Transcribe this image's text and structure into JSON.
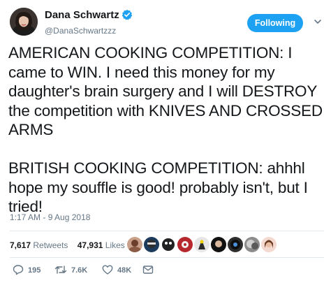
{
  "author": {
    "display_name": "Dana Schwartz",
    "handle": "@DanaSchwartzzz",
    "verified": true
  },
  "follow_button": {
    "label": "Following"
  },
  "tweet": {
    "text": "AMERICAN COOKING COMPETITION: I\ncame to WIN. I need this money for my\ndaughter's brain surgery and I will DESTROY\nthe competition with KNIVES AND CROSSED\nARMS\n\nBRITISH COOKING COMPETITION: ahhhl\nhope my souffle is good! probably isn't, but I\ntried!",
    "timestamp": "1:17 AM - 9 Aug 2018"
  },
  "stats": {
    "retweets_count": "7,617",
    "retweets_label": "Retweets",
    "likes_count": "47,931",
    "likes_label": "Likes"
  },
  "likers": [
    {
      "icon": "avatar"
    },
    {
      "icon": "avatar"
    },
    {
      "icon": "avatar"
    },
    {
      "icon": "avatar"
    },
    {
      "icon": "avatar"
    },
    {
      "icon": "avatar"
    },
    {
      "icon": "avatar"
    },
    {
      "icon": "avatar"
    },
    {
      "icon": "avatar"
    }
  ],
  "actions": {
    "reply_count": "195",
    "retweet_count": "7.6K",
    "like_count": "48K"
  },
  "colors": {
    "accent": "#1da1f2",
    "text": "#14171a",
    "secondary": "#657786",
    "divider": "#e1e8ed"
  }
}
